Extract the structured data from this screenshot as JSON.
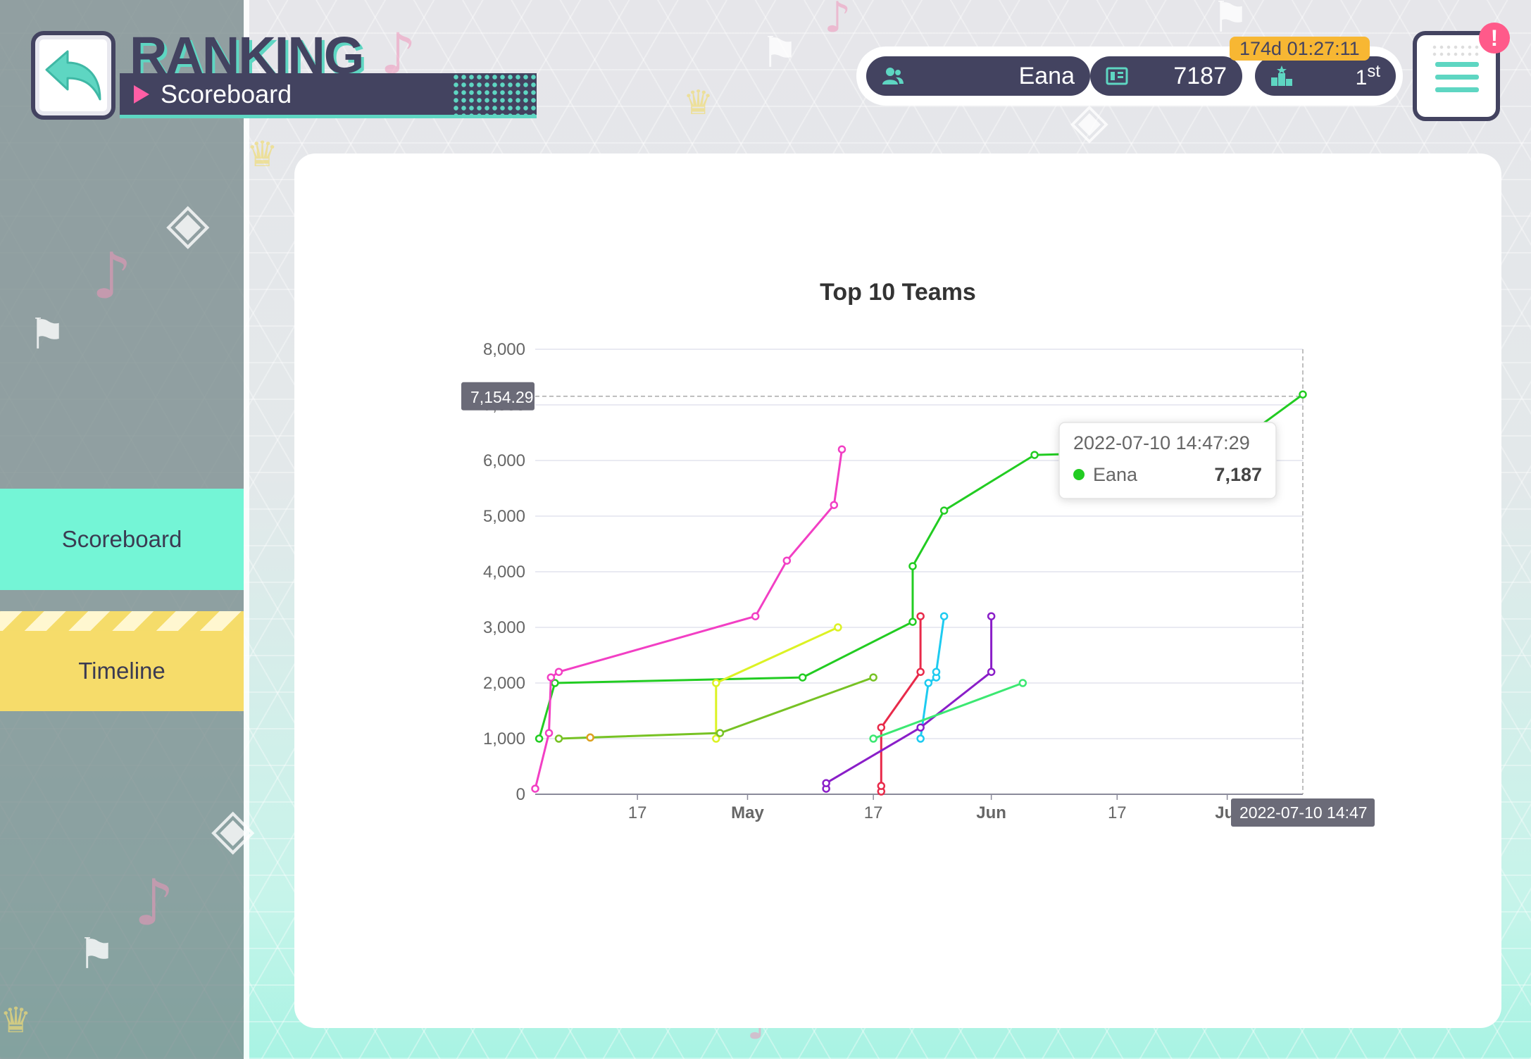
{
  "header": {
    "title": "RANKING",
    "subtitle": "Scoreboard"
  },
  "status": {
    "user_name": "Eana",
    "points": "7187",
    "rank_number": "1",
    "rank_suffix": "st",
    "countdown": "174d 01:27:11",
    "alert": "!"
  },
  "sidebar": {
    "items": [
      {
        "label": "Scoreboard",
        "active": true
      },
      {
        "label": "Timeline",
        "active": false
      }
    ]
  },
  "icons": {
    "back": "back-arrow-icon",
    "user": "user-icon",
    "points": "score-card-icon",
    "rank": "podium-icon",
    "menu": "hamburger-menu-icon"
  },
  "colors": {
    "accent": "#5ed6c2",
    "dark": "#434360",
    "active_nav": "#74f5d6",
    "timeline_nav": "#f6dc6a",
    "timer": "#f7b733",
    "alert": "#ff5a8a"
  },
  "chart_data": {
    "type": "line",
    "title": "Top 10 Teams",
    "xlabel": "",
    "ylabel": "",
    "ylim": [
      0,
      8000
    ],
    "yticks": [
      "0",
      "1,000",
      "2,000",
      "3,000",
      "4,000",
      "5,000",
      "6,000",
      "7,000",
      "8,000"
    ],
    "xlim": [
      "2022-04-04",
      "2022-07-10"
    ],
    "xticks": [
      {
        "date": "2022-04-17",
        "label": "17"
      },
      {
        "date": "2022-05-01",
        "label": "May"
      },
      {
        "date": "2022-05-17",
        "label": "17"
      },
      {
        "date": "2022-06-01",
        "label": "Jun"
      },
      {
        "date": "2022-06-17",
        "label": "17"
      },
      {
        "date": "2022-07-01",
        "label": "Jul"
      }
    ],
    "crosshair": {
      "y_label": "7,154.29",
      "x_label": "2022-07-10 14:47"
    },
    "tooltip": {
      "time": "2022-07-10 14:47:29",
      "series": "Eana",
      "value": "7,187"
    },
    "series": [
      {
        "name": "Eana",
        "color": "#22cc22",
        "points": [
          [
            "2022-04-04T12:00",
            1000
          ],
          [
            "2022-04-06T12:00",
            2000
          ],
          [
            "2022-05-08T00:00",
            2100
          ],
          [
            "2022-05-22T00:00",
            3100
          ],
          [
            "2022-05-22T00:00",
            4100
          ],
          [
            "2022-05-26T00:00",
            5100
          ],
          [
            "2022-06-06T12:00",
            6100
          ],
          [
            "2022-06-20T00:00",
            6150
          ],
          [
            "2022-07-03T00:00",
            6400
          ],
          [
            "2022-07-10T14:47",
            7187
          ]
        ]
      },
      {
        "color": "#f23fc4",
        "points": [
          [
            "2022-04-04T00:00",
            100
          ],
          [
            "2022-04-05T18:00",
            1100
          ],
          [
            "2022-04-06T00:00",
            2100
          ],
          [
            "2022-04-07T00:00",
            2200
          ],
          [
            "2022-05-02T00:00",
            3200
          ],
          [
            "2022-05-06T00:00",
            4200
          ],
          [
            "2022-05-12T00:00",
            5200
          ],
          [
            "2022-05-13T00:00",
            6200
          ]
        ]
      },
      {
        "color": "#dcf224",
        "points": [
          [
            "2022-04-27T00:00",
            1000
          ],
          [
            "2022-04-27T00:00",
            2000
          ],
          [
            "2022-05-12T12:00",
            3000
          ]
        ]
      },
      {
        "color": "#77c224",
        "points": [
          [
            "2022-04-07T00:00",
            1000
          ],
          [
            "2022-04-11T00:00",
            1020
          ],
          [
            "2022-04-27T12:00",
            1100
          ],
          [
            "2022-05-17T00:00",
            2100
          ]
        ]
      },
      {
        "color": "#e0a020",
        "points": [
          [
            "2022-04-11T00:00",
            1020
          ]
        ]
      },
      {
        "color": "#e82a4a",
        "points": [
          [
            "2022-05-18T00:00",
            50
          ],
          [
            "2022-05-18T00:00",
            150
          ],
          [
            "2022-05-18T00:00",
            1200
          ],
          [
            "2022-05-23T00:00",
            2200
          ],
          [
            "2022-05-23T00:00",
            3200
          ]
        ]
      },
      {
        "color": "#1ecbf0",
        "points": [
          [
            "2022-05-23T00:00",
            1000
          ],
          [
            "2022-05-24T00:00",
            2000
          ],
          [
            "2022-05-25T00:00",
            2100
          ],
          [
            "2022-05-25T00:00",
            2200
          ],
          [
            "2022-05-26T00:00",
            3200
          ]
        ]
      },
      {
        "color": "#8a1ec8",
        "points": [
          [
            "2022-05-11T00:00",
            100
          ],
          [
            "2022-05-11T00:00",
            200
          ],
          [
            "2022-05-23T00:00",
            1200
          ],
          [
            "2022-06-01T00:00",
            2200
          ],
          [
            "2022-06-01T00:00",
            3200
          ]
        ]
      },
      {
        "color": "#3ce872",
        "points": [
          [
            "2022-05-17T00:00",
            1000
          ],
          [
            "2022-06-05T00:00",
            2000
          ]
        ]
      }
    ]
  }
}
